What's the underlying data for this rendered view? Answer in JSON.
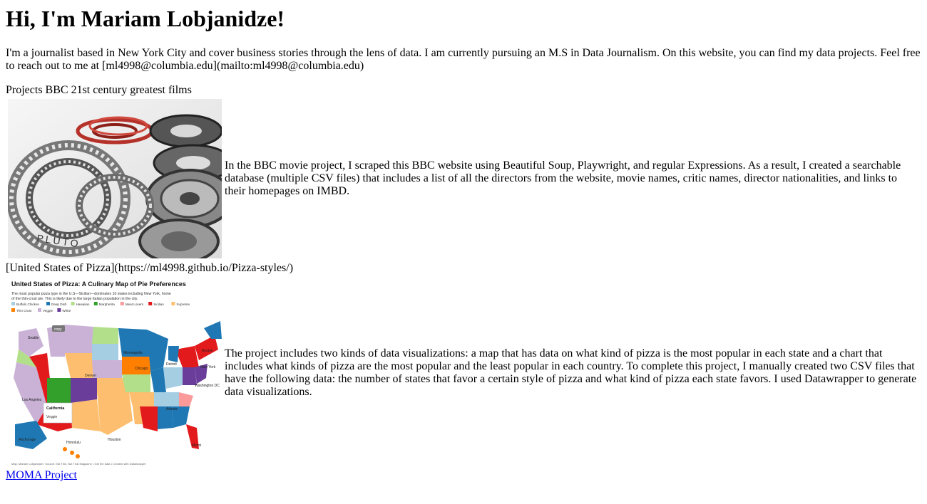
{
  "header": {
    "title": "Hi, I'm Mariam Lobjanidze!"
  },
  "intro": {
    "text": "I'm a journalist based in New York City and cover business stories through the lens of data. I am currently pursuing an M.S in Data Journalism. On this website, you can find my data projects. Feel free to reach out to me at [ml4998@columbia.edu](mailto:ml4998@columbia.edu)"
  },
  "projects_heading": "Projects BBC 21st century greatest films",
  "bbc": {
    "image_alt": "film reels",
    "image_text": "PLUTO",
    "description": "In the BBC movie project, I scraped this BBC website using Beautiful Soup, Playwright, and regular Expressions. As a result, I created a searchable database (multiple CSV files) that includes a list of all the directors from the website, movie names, critic names, director nationalities, and links to their homepages on IMBD."
  },
  "pizza_link_text": "[United States of Pizza](https://ml4998.github.io/Pizza-styles/)",
  "pizza": {
    "map_title": "United States of Pizza: A Culinary Map of Pie Preferences",
    "map_subtitle_1": "The most popular pizza type in the U.S—Sicilian—dominates 10 states including New York, home",
    "map_subtitle_2": "of the thin-crust pie. This is likely due to the large Italian population in the city.",
    "legend": [
      {
        "label": "Buffalo Chicken",
        "color": "#a6cee3"
      },
      {
        "label": "Deep Dish",
        "color": "#1f78b4"
      },
      {
        "label": "Hawaiian",
        "color": "#b2df8a"
      },
      {
        "label": "Margherita",
        "color": "#33a02c"
      },
      {
        "label": "Meat Lovers",
        "color": "#fb9a99"
      },
      {
        "label": "Sicilian",
        "color": "#e31a1c"
      },
      {
        "label": "Supreme",
        "color": "#fdbf6f"
      },
      {
        "label": "Thin Crust",
        "color": "#ff7f00"
      },
      {
        "label": "Veggie",
        "color": "#cab2d6"
      },
      {
        "label": "White",
        "color": "#6a3d9a"
      }
    ],
    "tooltip_state": "California",
    "tooltip_value": "Veggie",
    "copy_label": "copy",
    "cities": [
      "Seattle",
      "Minneapolis",
      "Chicago",
      "Detroit",
      "Boston",
      "New York",
      "Washington DC",
      "Denver",
      "Los Angeles",
      "Atlanta",
      "Houston",
      "Anchorage",
      "Honolulu",
      "Miami"
    ],
    "footer": "Map: Mariam Lobjanidze • Source: Eat This, Not That Magazine • Get the data • Created with Datawrapper",
    "description": "The project includes two kinds of data visualizations: a map that has data on what kind of pizza is the most popular in each state and a chart that includes what kinds of pizza are the most popular and the least popular in each country. To complete this project, I manually created two CSV files that have the following data: the number of states that favor a certain style of pizza and what kind of pizza each state favors. I used Datawrapper to generate data visualizations."
  },
  "moma_link": "MOMA Project",
  "colors": {
    "link": "#0000ee"
  }
}
